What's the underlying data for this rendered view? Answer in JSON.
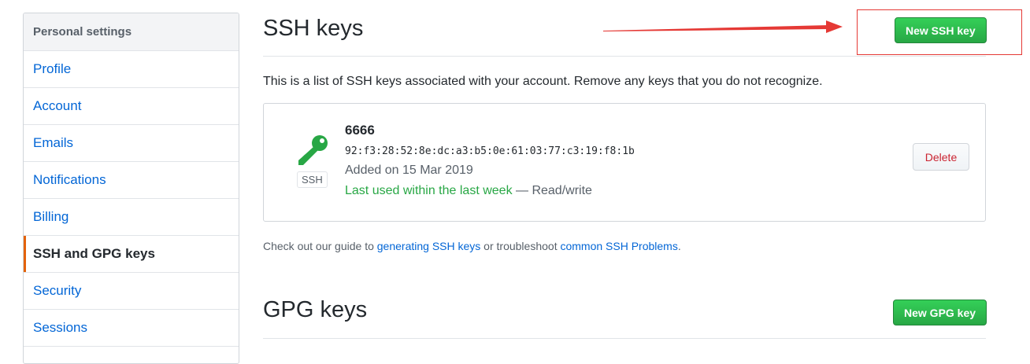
{
  "sidebar": {
    "header": "Personal settings",
    "items": [
      {
        "label": "Profile"
      },
      {
        "label": "Account"
      },
      {
        "label": "Emails"
      },
      {
        "label": "Notifications"
      },
      {
        "label": "Billing"
      },
      {
        "label": "SSH and GPG keys",
        "selected": true
      },
      {
        "label": "Security"
      },
      {
        "label": "Sessions"
      }
    ]
  },
  "ssh": {
    "title": "SSH keys",
    "new_button": "New SSH key",
    "intro": "This is a list of SSH keys associated with your account. Remove any keys that you do not recognize.",
    "key": {
      "type_label": "SSH",
      "name": "6666",
      "fingerprint": "92:f3:28:52:8e:dc:a3:b5:0e:61:03:77:c3:19:f8:1b",
      "added": "Added on 15 Mar 2019",
      "last_used": "Last used within the last week",
      "access": " — Read/write",
      "delete_label": "Delete"
    },
    "guide": {
      "prefix": "Check out our guide to ",
      "link1": "generating SSH keys",
      "middle": " or troubleshoot ",
      "link2": "common SSH Problems",
      "suffix": "."
    }
  },
  "gpg": {
    "title": "GPG keys",
    "new_button": "New GPG key"
  },
  "colors": {
    "accent_green": "#28a745",
    "link_blue": "#0366d6",
    "annotation_red": "#e53935",
    "selected_marker": "#e36209"
  }
}
